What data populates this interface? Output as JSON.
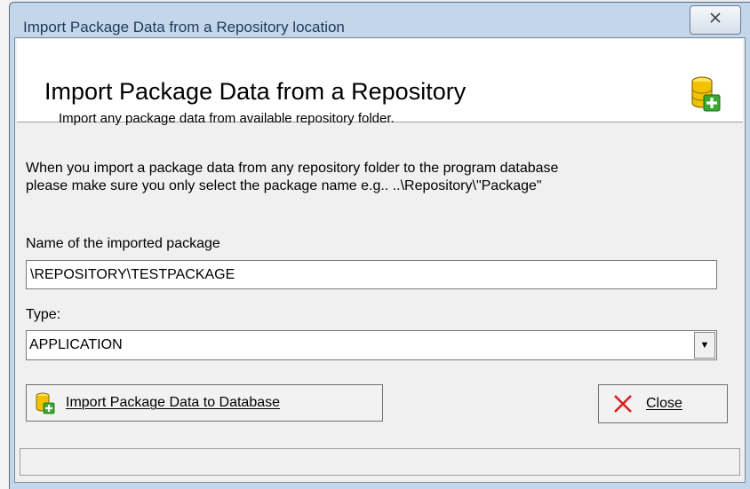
{
  "window": {
    "title": "Import Package Data from a Repository location",
    "close_glyph": "╳"
  },
  "header": {
    "title": "Import Package Data from a Repository",
    "subtitle": "Import any package data from available repository folder.",
    "icon": "database-add-icon"
  },
  "instructions": {
    "line1": "When you import a package data from any repository folder to the program database",
    "line2": "please make sure you only select the package name e.g.. ..\\Repository\\\"Package\""
  },
  "form": {
    "name_label": "Name of the imported package",
    "name_value": "\\REPOSITORY\\TESTPACKAGE",
    "type_label": "Type:",
    "type_value": "APPLICATION"
  },
  "buttons": {
    "import_label": "Import Package Data to Database",
    "close_label": "Close"
  },
  "colors": {
    "titlebar": "#c4d7ea",
    "close_x_red": "#d62020",
    "db_yellow": "#f2c200",
    "plus_green": "#3aa832"
  }
}
